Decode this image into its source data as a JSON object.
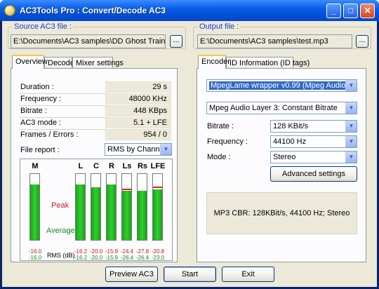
{
  "window": {
    "title": "AC3Tools Pro : Convert/Decode AC3",
    "minimize": "_",
    "maximize": "□",
    "close": "✕"
  },
  "source": {
    "group_title": "Source AC3 file :",
    "path": "E:\\Documents\\AC3 samples\\DD Ghost Train.ac3",
    "browse": "..."
  },
  "output": {
    "group_title": "Output file :",
    "path": "E:\\Documents\\AC3 samples\\test.mp3",
    "browse": "..."
  },
  "left_tabs": [
    "Overview",
    "Decoder",
    "Mixer settings"
  ],
  "right_tabs": [
    "Encoder",
    "ID Information (ID tags)"
  ],
  "overview": {
    "duration_label": "Duration :",
    "duration": "29 s",
    "frequency_label": "Frequency :",
    "frequency": "48000 KHz",
    "bitrate_label": "Bitrate :",
    "bitrate": "448 KBps",
    "mode_label": "AC3 mode :",
    "mode": "5.1 + LFE",
    "frames_label": "Frames / Errors :",
    "frames": "954 / 0",
    "file_report_label": "File report :",
    "file_report": "RMS by Channels"
  },
  "meters": {
    "peak_label": "Peak",
    "average_label": "Average",
    "rms_label": "RMS (dB)",
    "channels": [
      {
        "name": "M",
        "peak": "-16.0",
        "avg": "-16.0",
        "level": 0.84,
        "peak_level": null
      },
      {
        "name": "L",
        "peak": "-16.2",
        "avg": "-16.2",
        "level": 0.84,
        "peak_level": null
      },
      {
        "name": "C",
        "peak": "-20.0",
        "avg": "-20.0",
        "level": 0.8,
        "peak_level": null
      },
      {
        "name": "R",
        "peak": "-15.9",
        "avg": "-15.9",
        "level": 0.84,
        "peak_level": null
      },
      {
        "name": "Ls",
        "peak": "-24.4",
        "avg": "-26.4",
        "level": 0.74,
        "peak_level": 0.76
      },
      {
        "name": "Rs",
        "peak": "-27.8",
        "avg": "-26.4",
        "level": 0.74,
        "peak_level": null
      },
      {
        "name": "LFE",
        "peak": "-20.8",
        "avg": "-23.0",
        "level": 0.77,
        "peak_level": 0.79
      }
    ]
  },
  "encoder": {
    "codec": "MpegLame wrapper v0.99 (Mpeg Audio Layer 1,2,3)",
    "format": "Mpeg Audio Layer 3: Constant Bitrate",
    "bitrate_label": "Bitrate :",
    "bitrate": "128 KBit/s",
    "frequency_label": "Frequency :",
    "frequency": "44100 Hz",
    "mode_label": "Mode :",
    "mode": "Stereo",
    "advanced": "Advanced settings",
    "summary": "MP3 CBR: 128KBit/s, 44100 Hz; Stereo"
  },
  "buttons": {
    "preview": "Preview AC3",
    "start": "Start",
    "exit": "Exit"
  },
  "colors": {
    "peak": "#c41a1a",
    "average": "#1a8c1a",
    "accent": "#1d3cd8"
  }
}
